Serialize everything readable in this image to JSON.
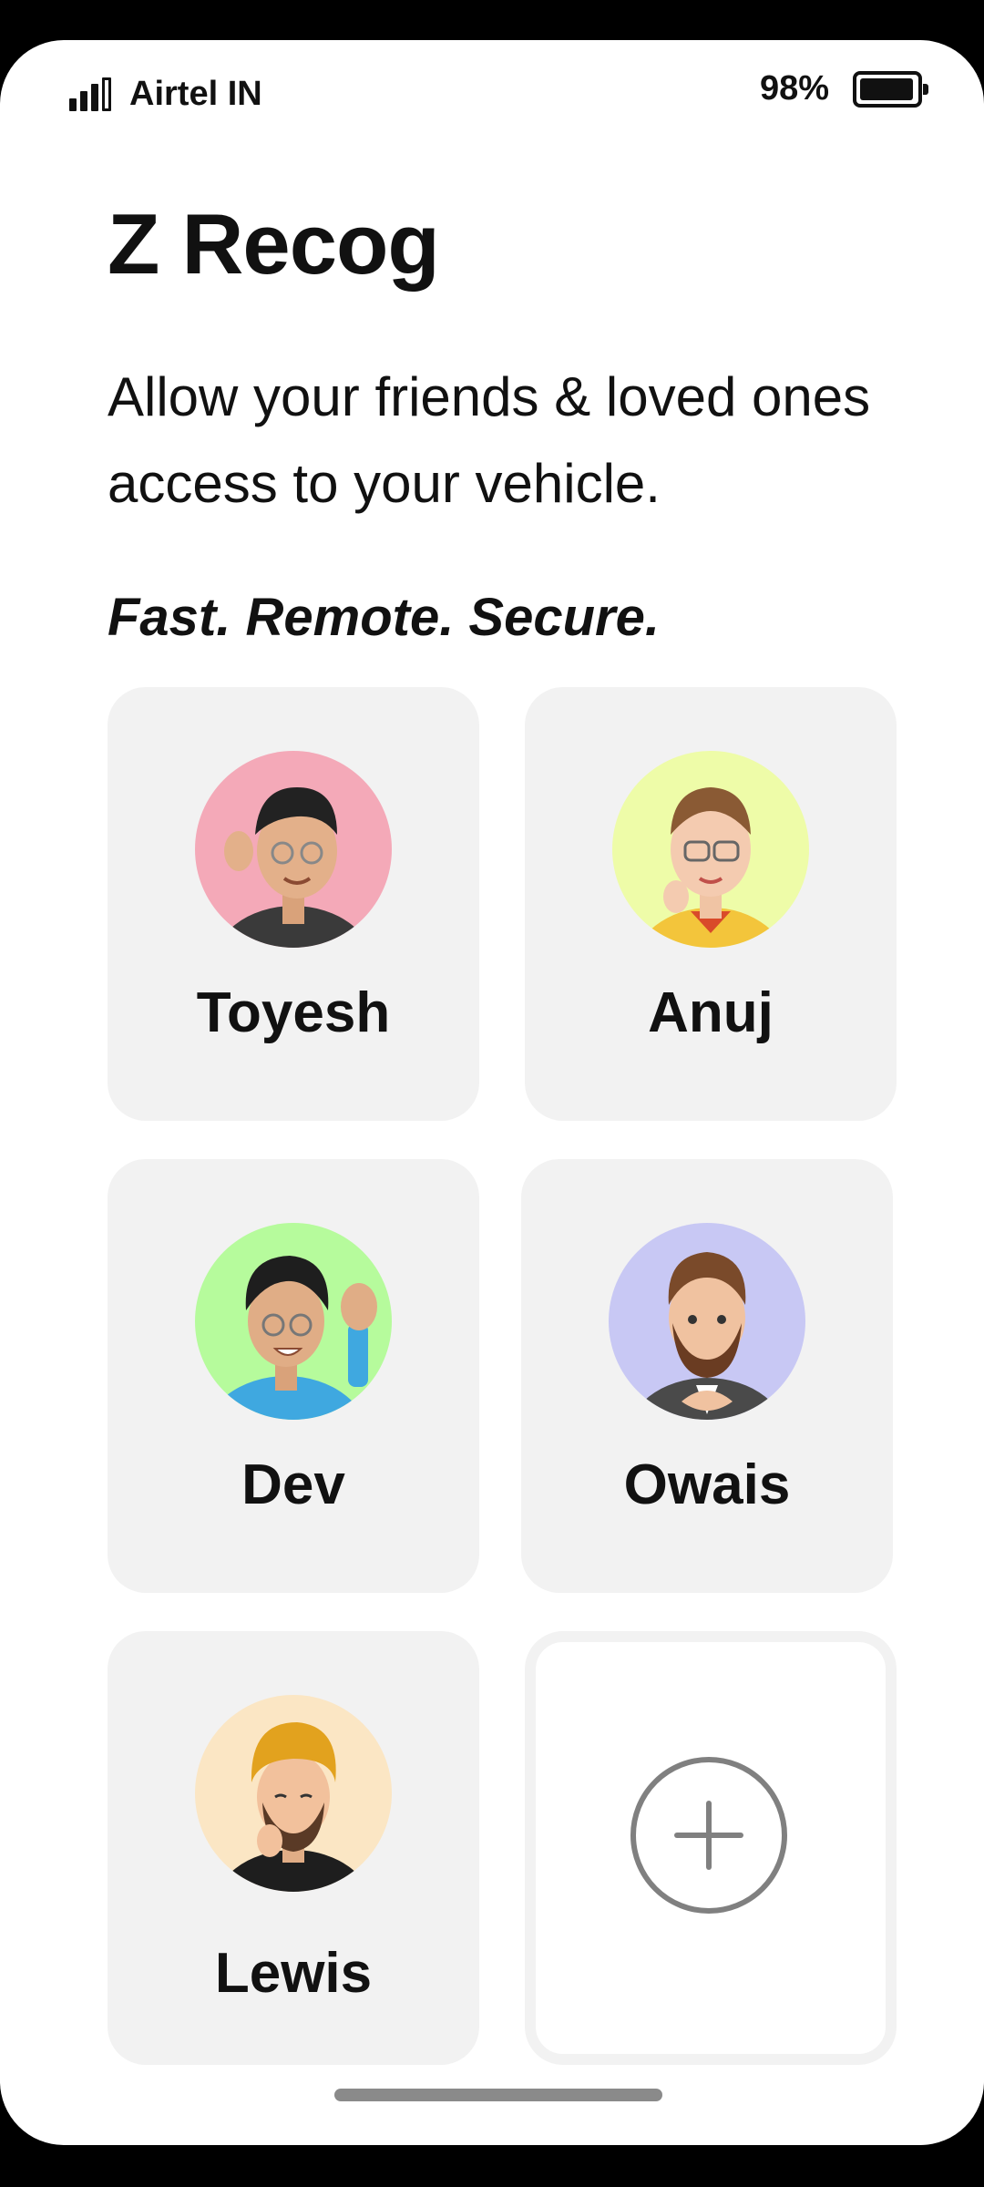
{
  "status_bar": {
    "carrier": "Airtel IN",
    "battery_percent": "98%",
    "battery_level": 0.98
  },
  "header": {
    "title": "Z Recog",
    "subtitle": "Allow your friends & loved ones access to your vehicle.",
    "tagline": "Fast. Remote. Secure."
  },
  "contacts": [
    {
      "name": "Toyesh",
      "avatar_bg": "#f4a9b8",
      "icon": "memoji-avatar-icon"
    },
    {
      "name": "Anuj",
      "avatar_bg": "#eefca8",
      "icon": "memoji-avatar-icon"
    },
    {
      "name": "Dev",
      "avatar_bg": "#b6fb9c",
      "icon": "memoji-avatar-icon"
    },
    {
      "name": "Owais",
      "avatar_bg": "#c8c8f4",
      "icon": "memoji-avatar-icon"
    },
    {
      "name": "Lewis",
      "avatar_bg": "#fbe6c4",
      "icon": "memoji-avatar-icon"
    }
  ],
  "add_button": {
    "icon": "plus-circle-icon"
  },
  "colors": {
    "card_bg": "#f2f2f2",
    "text": "#111111",
    "plus": "#808080"
  }
}
